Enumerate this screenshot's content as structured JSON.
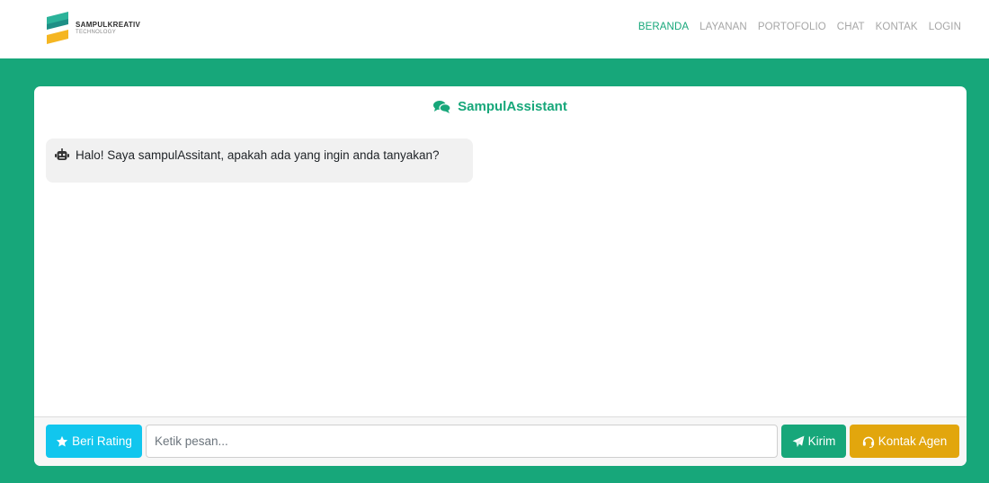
{
  "brand": {
    "name": "SAMPULKREATIV",
    "tagline": "TECHNOLOGY",
    "colors": {
      "primary": "#17a77a",
      "secondary": "#f5b622",
      "teal": "#2bb39a"
    }
  },
  "nav": {
    "items": [
      {
        "label": "BERANDA",
        "active": true
      },
      {
        "label": "LAYANAN",
        "active": false
      },
      {
        "label": "PORTOFOLIO",
        "active": false
      },
      {
        "label": "CHAT",
        "active": false
      },
      {
        "label": "KONTAK",
        "active": false
      },
      {
        "label": "LOGIN",
        "active": false
      }
    ]
  },
  "chat": {
    "title": "SampulAssistant",
    "title_icon": "comments-icon",
    "messages": [
      {
        "sender_icon": "robot-icon",
        "text": "Halo! Saya sampulAssitant, apakah ada yang ingin anda tanyakan?"
      }
    ]
  },
  "composer": {
    "rating_label": "Beri Rating",
    "rating_icon": "star-icon",
    "placeholder": "Ketik pesan...",
    "value": "",
    "send_label": "Kirim",
    "send_icon": "paper-plane-icon",
    "agent_label": "Kontak Agen",
    "agent_icon": "headset-icon"
  },
  "colors": {
    "page_bg": "#17a77a",
    "rating_button": "#11c6ee",
    "send_button": "#17a77a",
    "agent_button": "#e2a60d"
  }
}
